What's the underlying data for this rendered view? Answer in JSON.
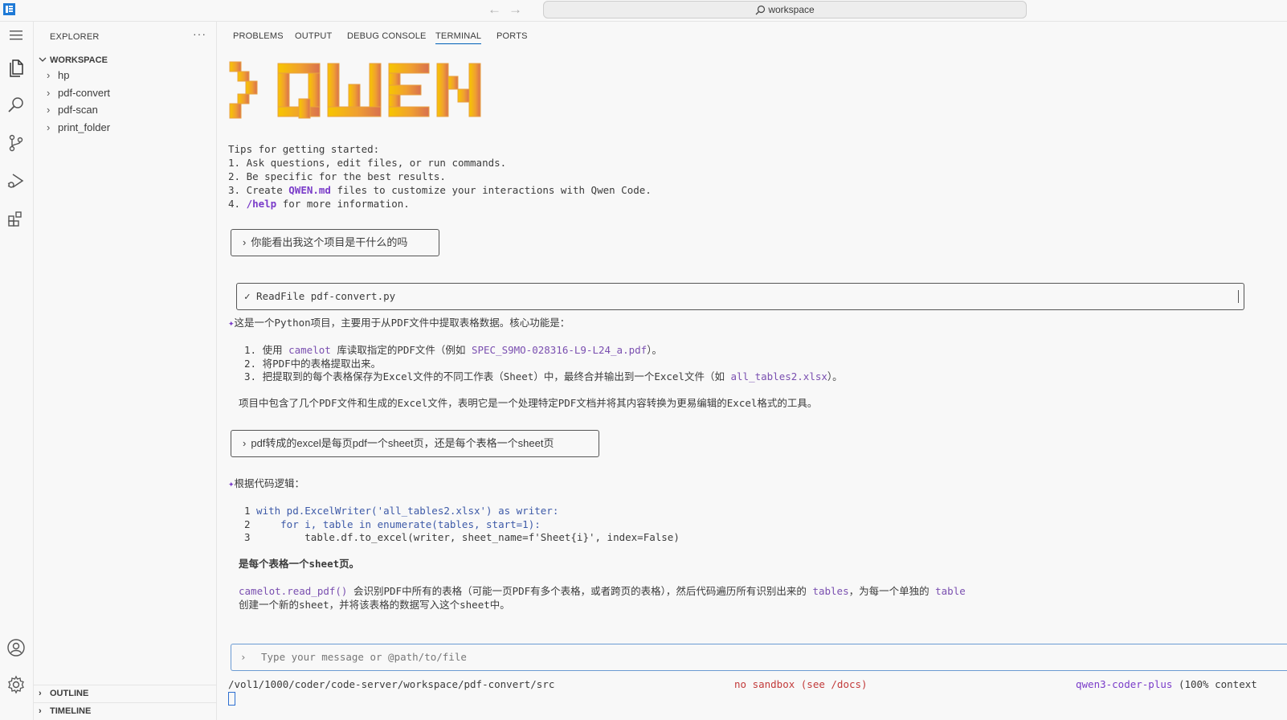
{
  "titlebar": {
    "search_text": "workspace"
  },
  "sidebar": {
    "explorer_title": "EXPLORER",
    "workspace_label": "WORKSPACE",
    "items": [
      {
        "label": "hp"
      },
      {
        "label": "pdf-convert"
      },
      {
        "label": "pdf-scan"
      },
      {
        "label": "print_folder"
      }
    ],
    "outline_label": "OUTLINE",
    "timeline_label": "TIMELINE"
  },
  "panel": {
    "tabs": [
      {
        "label": "PROBLEMS"
      },
      {
        "label": "OUTPUT"
      },
      {
        "label": "DEBUG CONSOLE"
      },
      {
        "label": "TERMINAL",
        "active": true
      },
      {
        "label": "PORTS"
      }
    ]
  },
  "terminal": {
    "logo_text": "> QWEN",
    "tips_title": "Tips for getting started:",
    "tips": {
      "t1": "1. Ask questions, edit files, or run commands.",
      "t2": "2. Be specific for the best results.",
      "t3_a": "3. Create ",
      "t3_b": "QWEN.md",
      "t3_c": " files to customize your interactions with Qwen Code.",
      "t4_a": "4. ",
      "t4_b": "/help",
      "t4_c": " for more information."
    },
    "user_msg_1": "你能看出我这个项目是干什么的吗",
    "readfile": "✓ ReadFile pdf-convert.py",
    "answer1": {
      "intro": "这是一个Python项目，主要用于从PDF文件中提取表格数据。核心功能是：",
      "l1_a": "1. 使用 ",
      "l1_b": "camelot",
      "l1_c": " 库读取指定的PDF文件（例如 ",
      "l1_d": "SPEC_S9MO-028316-L9-L24_a.pdf",
      "l1_e": "）。",
      "l2": "2. 将PDF中的表格提取出来。",
      "l3_a": "3. 把提取到的每个表格保存为Excel文件的不同工作表（Sheet）中，最终合并输出到一个Excel文件（如 ",
      "l3_b": "all_tables2.xlsx",
      "l3_c": "）。",
      "summary": "项目中包含了几个PDF文件和生成的Excel文件，表明它是一个处理特定PDF文档并将其内容转换为更易编辑的Excel格式的工具。"
    },
    "user_msg_2": "pdf转成的excel是每页pdf一个sheet页，还是每个表格一个sheet页",
    "answer2": {
      "intro": "根据代码逻辑：",
      "code": [
        {
          "num": "1",
          "text": " with pd.ExcelWriter('all_tables2.xlsx') as writer:"
        },
        {
          "num": "2",
          "text": "     for i, table in enumerate(tables, start=1):"
        },
        {
          "num": "3",
          "text": "         table.df.to_excel(writer, sheet_name=f'Sheet{i}', index=False)"
        }
      ],
      "conclusion": "是每个表格一个sheet页。",
      "detail_a": "camelot.read_pdf()",
      "detail_b": " 会识别PDF中所有的表格（可能一页PDF有多个表格，或者跨页的表格），然后代码遍历所有识别出来的 ",
      "detail_c": "tables",
      "detail_d": "，为每一个单独的 ",
      "detail_e": "table",
      "detail_2": "创建一个新的sheet，并将该表格的数据写入这个sheet中。"
    },
    "input_placeholder": "Type your message or @path/to/file",
    "status": {
      "path": "/vol1/1000/coder/code-server/workspace/pdf-convert/src",
      "sandbox": "no sandbox (see /docs)",
      "model": "qwen3-coder-plus",
      "context": " (100% context"
    }
  },
  "colors": {
    "accent": "#005fb8",
    "purple": "#7a3cc9",
    "logo_gradient": [
      "#f5c400",
      "#f0a030",
      "#d87050"
    ]
  }
}
